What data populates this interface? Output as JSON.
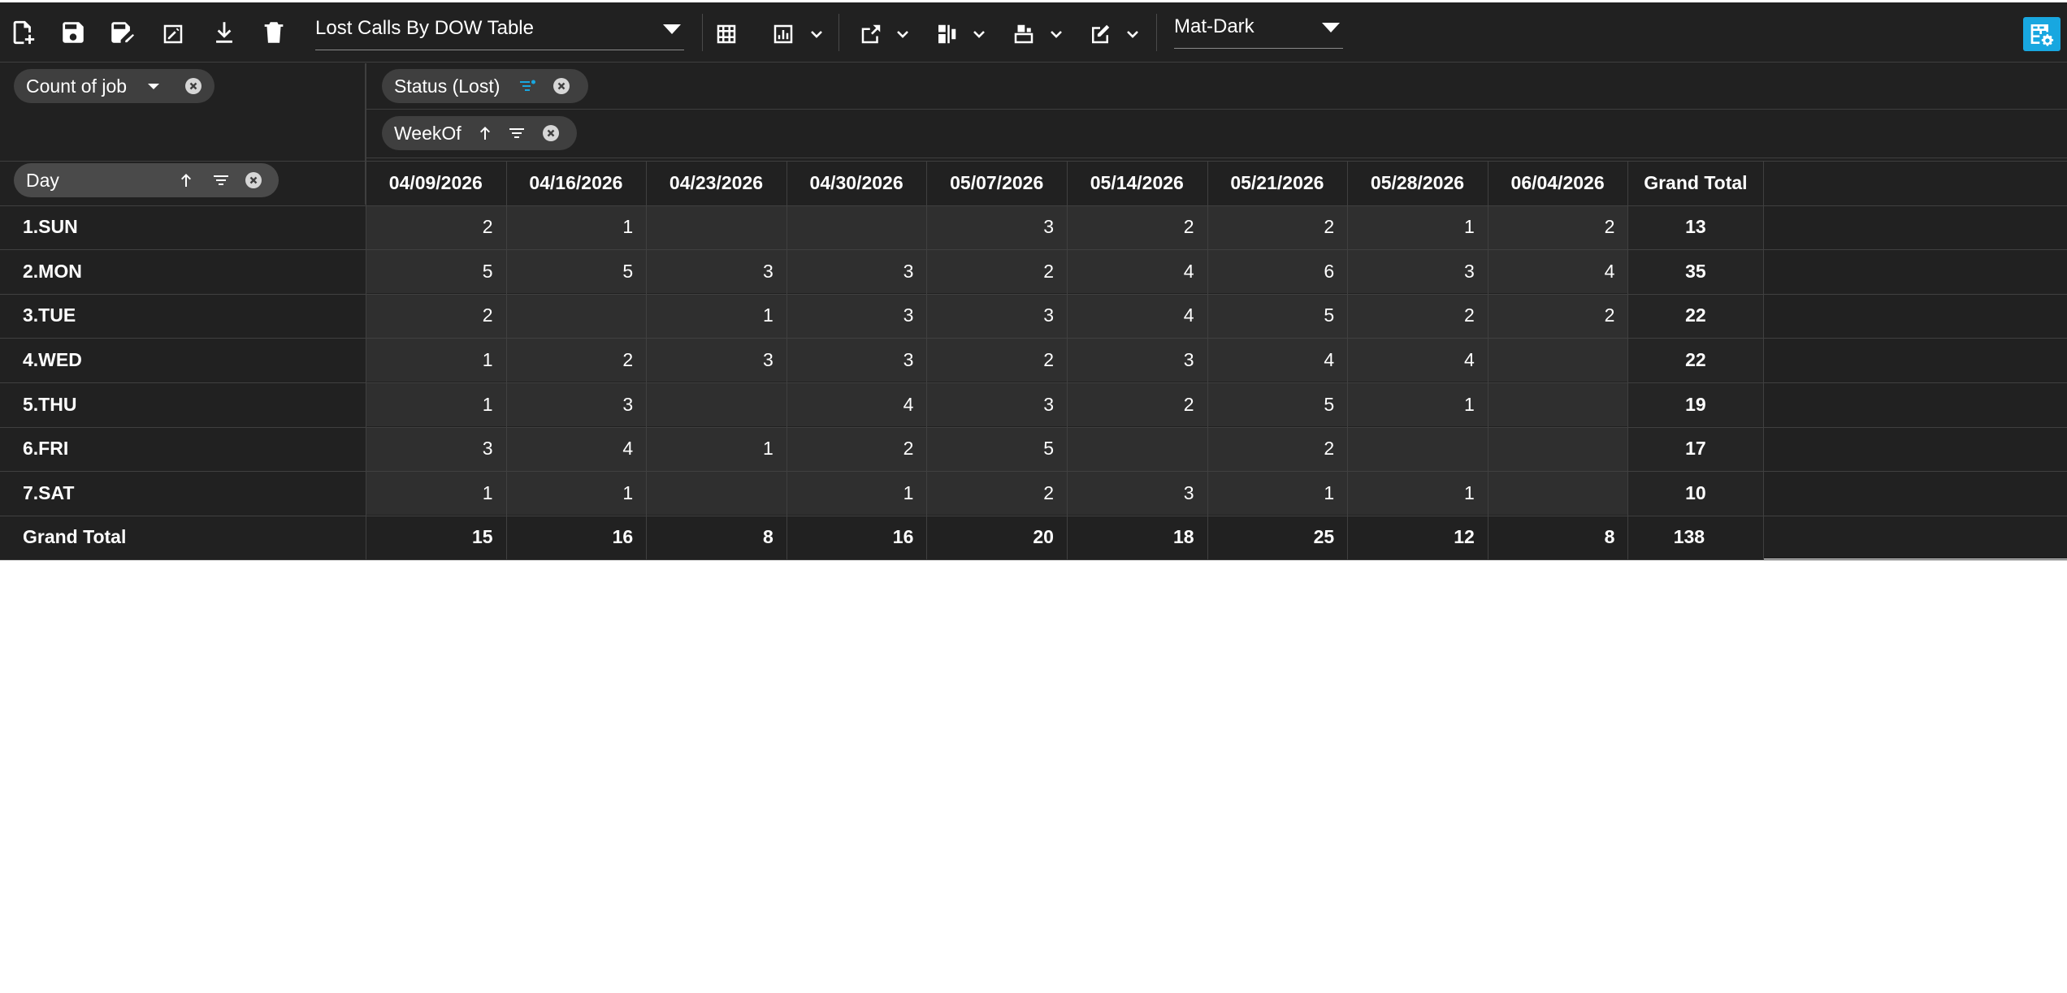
{
  "toolbar": {
    "report_name": "Lost Calls By DOW Table",
    "theme": "Mat-Dark",
    "icons": [
      "new-report-icon",
      "save-icon",
      "save-as-icon",
      "rename-icon",
      "download-icon",
      "delete-icon",
      "grid-icon",
      "chart-icon",
      "export-icon",
      "format-icon",
      "options-icon",
      "edit-icon",
      "settings-icon"
    ]
  },
  "fields": {
    "measure": "Count of job",
    "column_fields": [
      "Status (Lost)",
      "WeekOf"
    ],
    "row_field": "Day"
  },
  "table": {
    "columns": [
      "04/09/2026",
      "04/16/2026",
      "04/23/2026",
      "04/30/2026",
      "05/07/2026",
      "05/14/2026",
      "05/21/2026",
      "05/28/2026",
      "06/04/2026"
    ],
    "grand_total_label": "Grand Total",
    "rows": [
      {
        "label": "1.SUN",
        "values": [
          "2",
          "1",
          "",
          "",
          "3",
          "2",
          "2",
          "1",
          "2"
        ],
        "total": "13"
      },
      {
        "label": "2.MON",
        "values": [
          "5",
          "5",
          "3",
          "3",
          "2",
          "4",
          "6",
          "3",
          "4"
        ],
        "total": "35"
      },
      {
        "label": "3.TUE",
        "values": [
          "2",
          "",
          "1",
          "3",
          "3",
          "4",
          "5",
          "2",
          "2"
        ],
        "total": "22"
      },
      {
        "label": "4.WED",
        "values": [
          "1",
          "2",
          "3",
          "3",
          "2",
          "3",
          "4",
          "4",
          ""
        ],
        "total": "22"
      },
      {
        "label": "5.THU",
        "values": [
          "1",
          "3",
          "",
          "4",
          "3",
          "2",
          "5",
          "1",
          ""
        ],
        "total": "19"
      },
      {
        "label": "6.FRI",
        "values": [
          "3",
          "4",
          "1",
          "2",
          "5",
          "",
          "2",
          "",
          ""
        ],
        "total": "17"
      },
      {
        "label": "7.SAT",
        "values": [
          "1",
          "1",
          "",
          "1",
          "2",
          "3",
          "1",
          "1",
          ""
        ],
        "total": "10"
      }
    ],
    "grand_total_row": {
      "label": "Grand Total",
      "values": [
        "15",
        "16",
        "8",
        "16",
        "20",
        "18",
        "25",
        "12",
        "8"
      ],
      "total": "138"
    }
  },
  "colors": {
    "background": "#212121",
    "cell": "#2f2f2f",
    "accent": "#18a7e0"
  }
}
